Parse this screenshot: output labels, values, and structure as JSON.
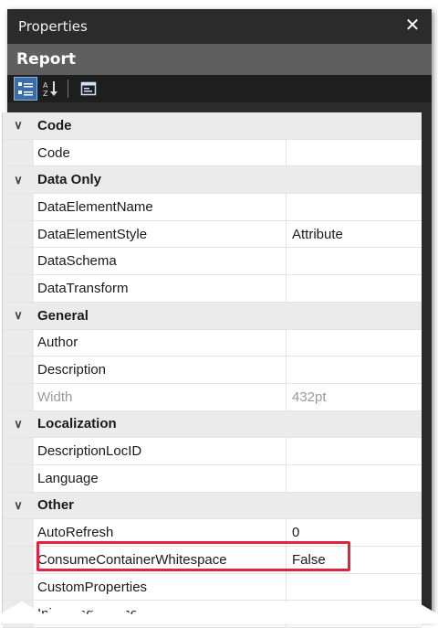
{
  "panel": {
    "title": "Properties",
    "object_name": "Report"
  },
  "toolbar": {
    "buttons": [
      {
        "icon": "categorized-icon",
        "active": true
      },
      {
        "icon": "sort-alphabetical-icon",
        "active": false
      },
      {
        "icon": "property-pages-icon",
        "active": false
      }
    ]
  },
  "grid": {
    "rows": [
      {
        "kind": "category",
        "label": "Code"
      },
      {
        "kind": "prop",
        "name": "Code",
        "value": ""
      },
      {
        "kind": "category",
        "label": "Data Only"
      },
      {
        "kind": "prop",
        "name": "DataElementName",
        "value": ""
      },
      {
        "kind": "prop",
        "name": "DataElementStyle",
        "value": "Attribute"
      },
      {
        "kind": "prop",
        "name": "DataSchema",
        "value": ""
      },
      {
        "kind": "prop",
        "name": "DataTransform",
        "value": ""
      },
      {
        "kind": "category",
        "label": "General"
      },
      {
        "kind": "prop",
        "name": "Author",
        "value": ""
      },
      {
        "kind": "prop",
        "name": "Description",
        "value": ""
      },
      {
        "kind": "prop",
        "name": "Width",
        "value": "432pt",
        "dim": true
      },
      {
        "kind": "category",
        "label": "Localization"
      },
      {
        "kind": "prop",
        "name": "DescriptionLocID",
        "value": ""
      },
      {
        "kind": "prop",
        "name": "Language",
        "value": ""
      },
      {
        "kind": "category",
        "label": "Other"
      },
      {
        "kind": "prop",
        "name": "AutoRefresh",
        "value": "0"
      },
      {
        "kind": "prop",
        "name": "ConsumeContainerWhitespace",
        "value": "False",
        "highlight": true
      },
      {
        "kind": "prop",
        "name": "CustomProperties",
        "value": ""
      },
      {
        "kind": "prop",
        "name": "InitialPageName",
        "value": ""
      }
    ]
  },
  "colors": {
    "highlight": "#e0233f",
    "title_bg": "#2b2b2b",
    "object_bar": "#5f5f5f"
  }
}
